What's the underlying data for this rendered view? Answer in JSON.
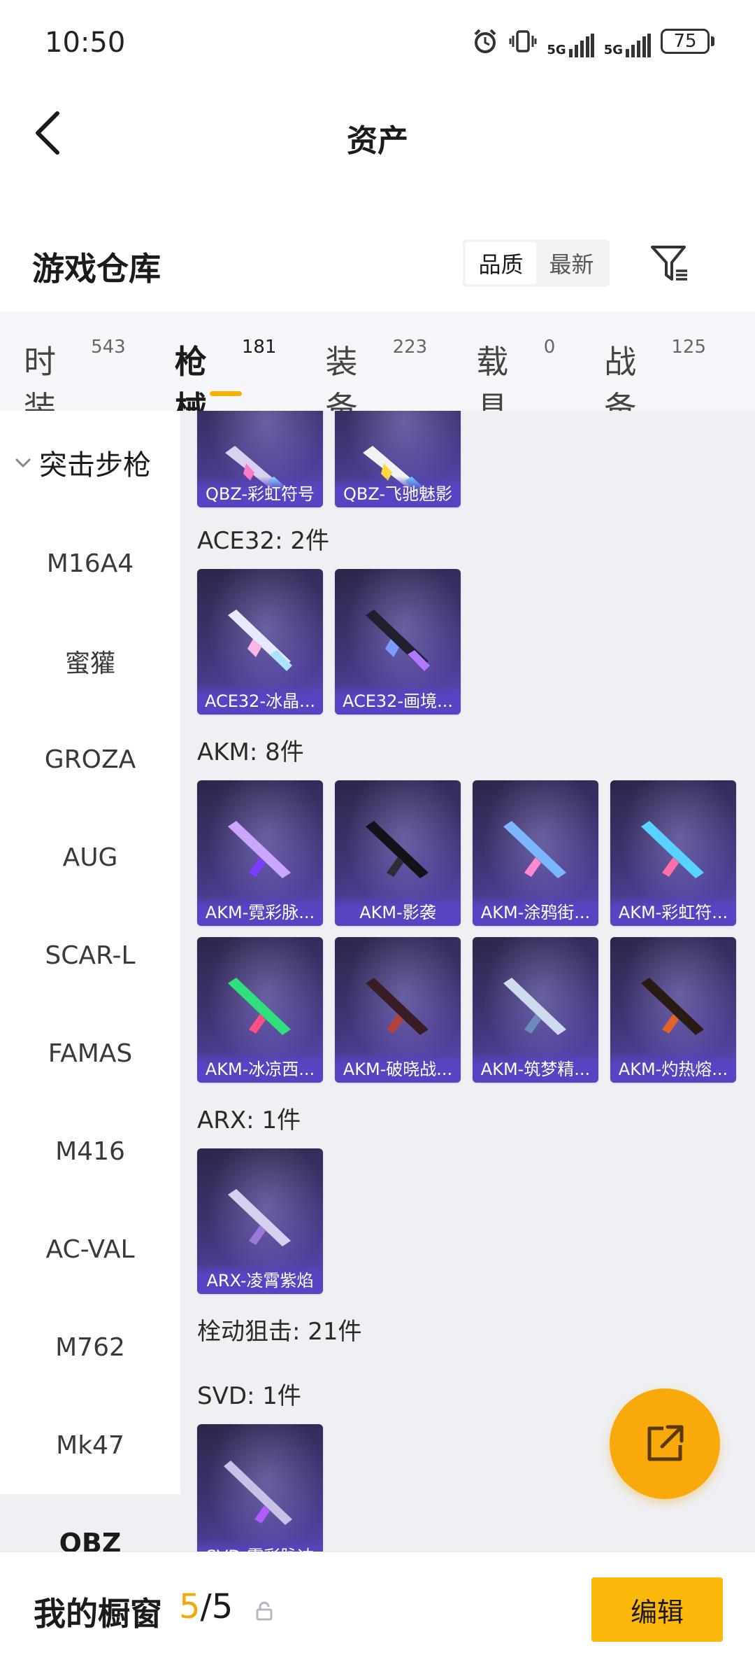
{
  "status_bar": {
    "time": "10:50",
    "network_1": "5G",
    "network_2": "5G",
    "battery": "75"
  },
  "nav": {
    "title": "资产"
  },
  "section": {
    "title": "游戏仓库",
    "sort_options": [
      "品质",
      "最新"
    ],
    "sort_selected": "品质"
  },
  "category_tabs": [
    {
      "label": "时装",
      "count": "543"
    },
    {
      "label": "枪械",
      "count": "181",
      "active": true
    },
    {
      "label": "装备",
      "count": "223"
    },
    {
      "label": "载具",
      "count": "0"
    },
    {
      "label": "战备",
      "count": "125"
    }
  ],
  "sidebar": {
    "group_label": "突击步枪",
    "items": [
      "M16A4",
      "蜜獾",
      "GROZA",
      "AUG",
      "SCAR-L",
      "FAMAS",
      "M416",
      "AC-VAL",
      "M762",
      "Mk47",
      "QBZ"
    ],
    "active_item": "QBZ"
  },
  "main": {
    "top_cards": [
      "QBZ-彩虹符号",
      "QBZ-飞驰魅影"
    ],
    "groups": [
      {
        "heading": "ACE32: 2件",
        "cards": [
          "ACE32-冰晶...",
          "ACE32-画境..."
        ]
      },
      {
        "heading": "AKM: 8件",
        "cards": [
          "AKM-霓彩脉...",
          "AKM-影袭",
          "AKM-涂鸦街...",
          "AKM-彩虹符...",
          "AKM-冰凉西...",
          "AKM-破晓战...",
          "AKM-筑梦精...",
          "AKM-灼热熔..."
        ]
      },
      {
        "heading": "ARX: 1件",
        "cards": [
          "ARX-凌霄紫焰"
        ]
      },
      {
        "heading": "栓动狙击: 21件",
        "cards": []
      },
      {
        "heading": "SVD: 1件",
        "cards": [
          "SVD-霓彩脉冲"
        ]
      }
    ]
  },
  "bottom_bar": {
    "title": "我的橱窗",
    "slots_used": "5",
    "slots_total": "/5",
    "edit_label": "编辑"
  },
  "colors": {
    "accent": "#f6b100",
    "card_purple": "#5d48b8",
    "card_dark": "#2d2648",
    "content_bg": "#eef0f4"
  },
  "icons": {
    "back": "chevron-left-icon",
    "filter": "filter-icon",
    "fab": "share-external-icon",
    "lock": "lock-icon",
    "alarm": "alarm-icon",
    "vibrate": "vibrate-icon"
  }
}
